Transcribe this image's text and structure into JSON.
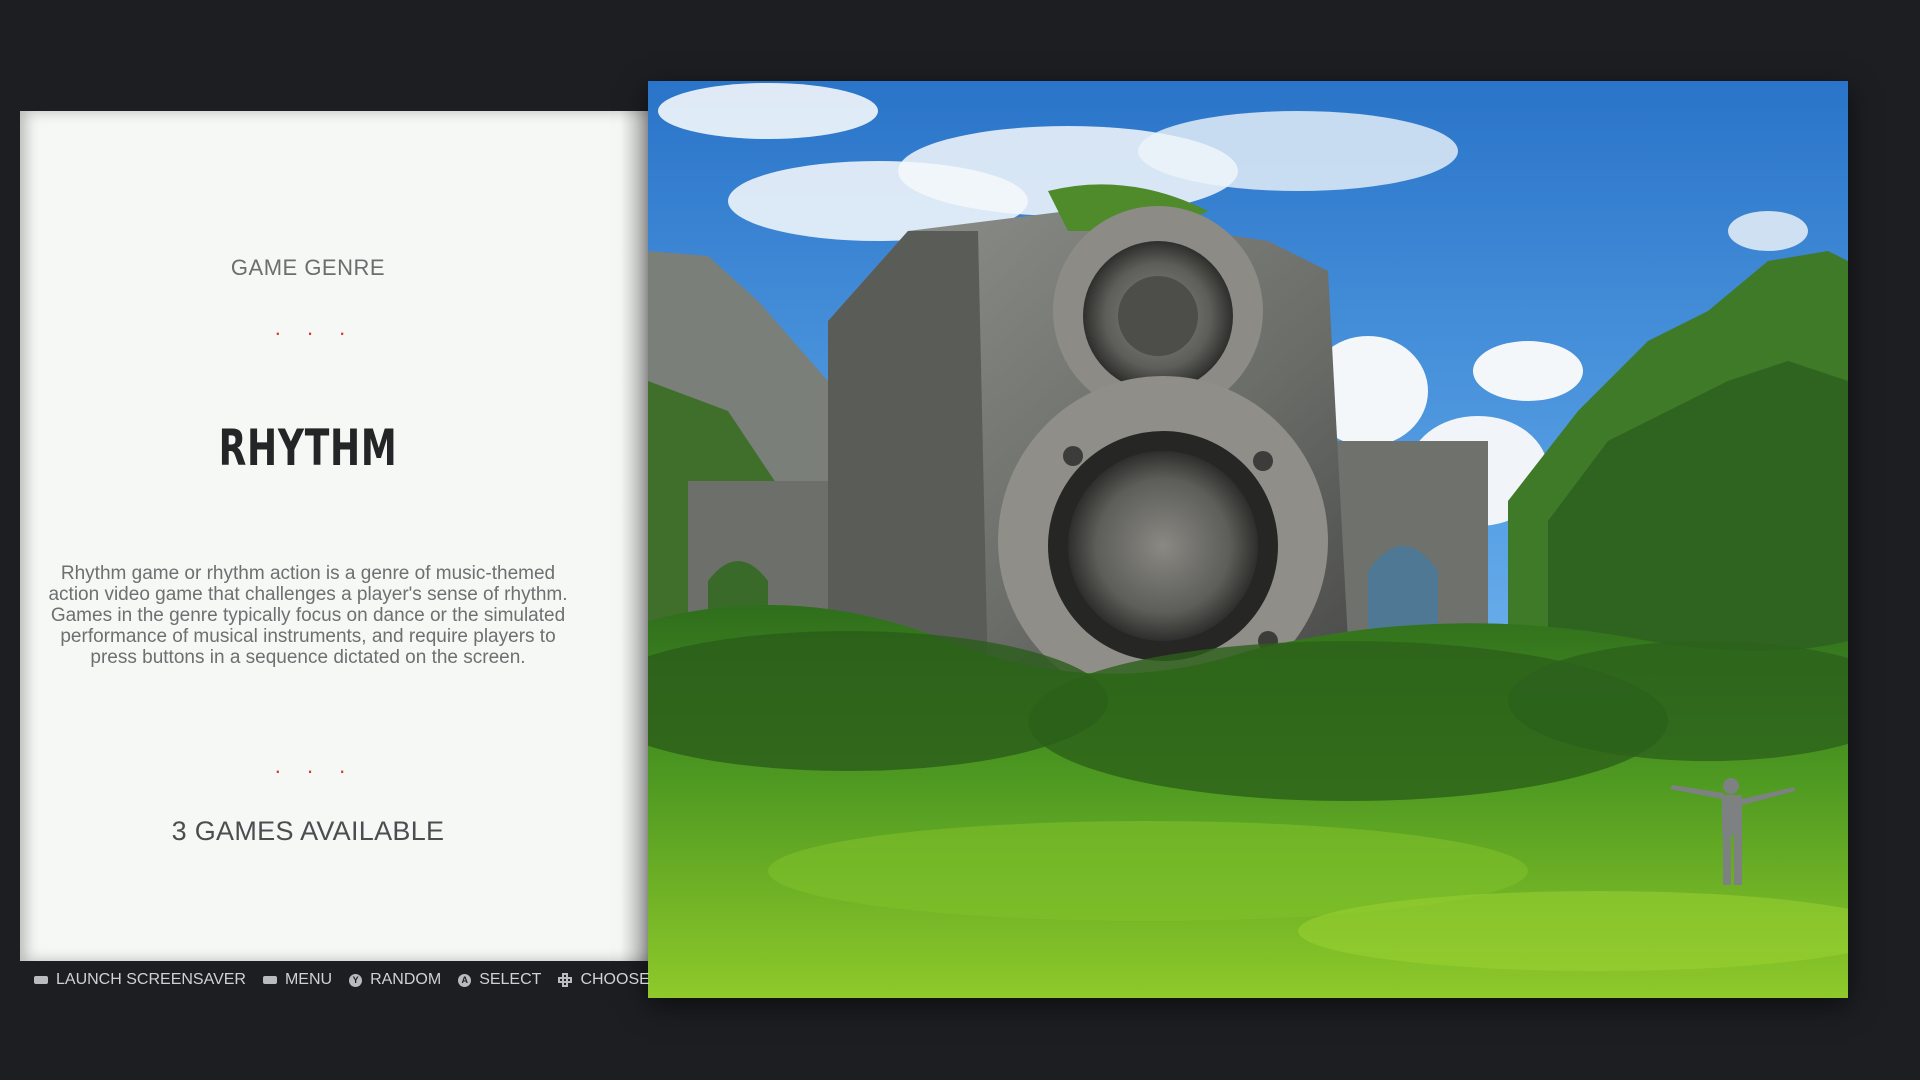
{
  "panel": {
    "genre_label": "GAME GENRE",
    "separator": ". . .",
    "genre_title": "RHYTHM",
    "description": "Rhythm game or rhythm action is a genre of music-themed action video game that challenges a player's sense of rhythm. Games in the genre typically focus on dance or the simulated performance of musical instruments, and require players to press buttons in a sequence dictated on the screen.",
    "games_count": "3 GAMES AVAILABLE"
  },
  "help_bar": {
    "items": [
      {
        "icon": "select-button-icon",
        "label": "LAUNCH SCREENSAVER"
      },
      {
        "icon": "start-button-icon",
        "label": "MENU"
      },
      {
        "icon": "y-button-icon",
        "glyph": "Y",
        "label": "RANDOM"
      },
      {
        "icon": "a-button-icon",
        "glyph": "A",
        "label": "SELECT"
      },
      {
        "icon": "dpad-icon",
        "label": "CHOOSE"
      }
    ]
  },
  "colors": {
    "background": "#1d1e22",
    "panel": "#f6f8f6",
    "accent_dots": "#d23a2e",
    "title": "#242526"
  }
}
